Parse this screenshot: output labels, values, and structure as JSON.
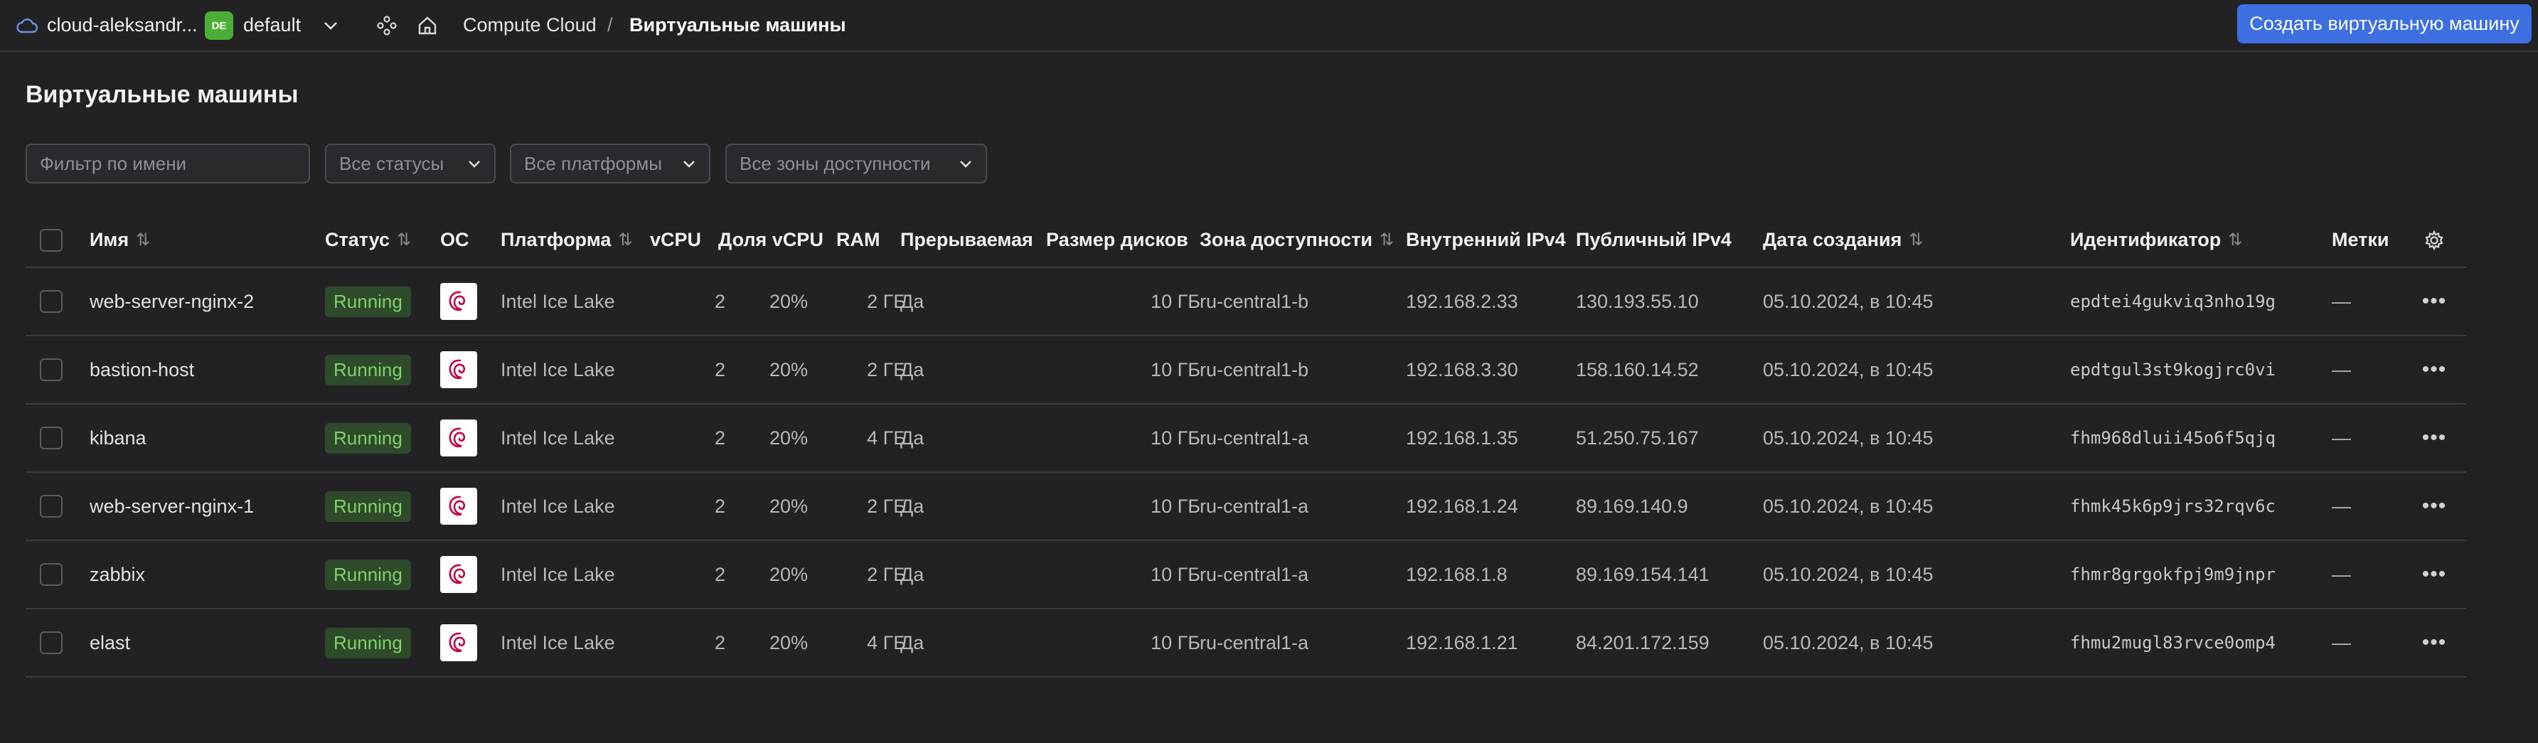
{
  "topbar": {
    "cloud_name": "cloud-aleksandr...",
    "folder_badge": "DE",
    "folder_name": "default",
    "breadcrumb": [
      "Compute Cloud",
      "/",
      "Виртуальные машины"
    ],
    "create_button": "Создать виртуальную машину",
    "icons": [
      "cloud-icon",
      "chevron-down-icon",
      "services-icon",
      "home-icon"
    ]
  },
  "page": {
    "title": "Виртуальные машины"
  },
  "filters": {
    "name_placeholder": "Фильтр по имени",
    "status": "Все статусы",
    "platform": "Все платформы",
    "zone": "Все зоны доступности"
  },
  "table": {
    "columns": [
      "Имя",
      "Статус",
      "ОС",
      "Платформа",
      "vCPU",
      "Доля vCPU",
      "RAM",
      "Прерываемая",
      "Размер дисков",
      "Зона доступности",
      "Внутренний IPv4",
      "Публичный IPv4",
      "Дата создания",
      "Идентификатор",
      "Метки"
    ],
    "rows": [
      {
        "name": "web-server-nginx-2",
        "status": "Running",
        "platform": "Intel Ice Lake",
        "vcpu": "2",
        "share": "20%",
        "ram": "2 ГБ",
        "preemptible": "Да",
        "disk": "10 ГБ",
        "zone": "ru-central1-b",
        "ip_internal": "192.168.2.33",
        "ip_public": "130.193.55.10",
        "created": "05.10.2024, в 10:45",
        "id": "epdtei4gukviq3nho19g",
        "labels": "—"
      },
      {
        "name": "bastion-host",
        "status": "Running",
        "platform": "Intel Ice Lake",
        "vcpu": "2",
        "share": "20%",
        "ram": "2 ГБ",
        "preemptible": "Да",
        "disk": "10 ГБ",
        "zone": "ru-central1-b",
        "ip_internal": "192.168.3.30",
        "ip_public": "158.160.14.52",
        "created": "05.10.2024, в 10:45",
        "id": "epdtgul3st9kogjrc0vi",
        "labels": "—"
      },
      {
        "name": "kibana",
        "status": "Running",
        "platform": "Intel Ice Lake",
        "vcpu": "2",
        "share": "20%",
        "ram": "4 ГБ",
        "preemptible": "Да",
        "disk": "10 ГБ",
        "zone": "ru-central1-a",
        "ip_internal": "192.168.1.35",
        "ip_public": "51.250.75.167",
        "created": "05.10.2024, в 10:45",
        "id": "fhm968dluii45o6f5qjq",
        "labels": "—"
      },
      {
        "name": "web-server-nginx-1",
        "status": "Running",
        "platform": "Intel Ice Lake",
        "vcpu": "2",
        "share": "20%",
        "ram": "2 ГБ",
        "preemptible": "Да",
        "disk": "10 ГБ",
        "zone": "ru-central1-a",
        "ip_internal": "192.168.1.24",
        "ip_public": "89.169.140.9",
        "created": "05.10.2024, в 10:45",
        "id": "fhmk45k6p9jrs32rqv6c",
        "labels": "—"
      },
      {
        "name": "zabbix",
        "status": "Running",
        "platform": "Intel Ice Lake",
        "vcpu": "2",
        "share": "20%",
        "ram": "2 ГБ",
        "preemptible": "Да",
        "disk": "10 ГБ",
        "zone": "ru-central1-a",
        "ip_internal": "192.168.1.8",
        "ip_public": "89.169.154.141",
        "created": "05.10.2024, в 10:45",
        "id": "fhmr8grgokfpj9m9jnpr",
        "labels": "—"
      },
      {
        "name": "elast",
        "status": "Running",
        "platform": "Intel Ice Lake",
        "vcpu": "2",
        "share": "20%",
        "ram": "4 ГБ",
        "preemptible": "Да",
        "disk": "10 ГБ",
        "zone": "ru-central1-a",
        "ip_internal": "192.168.1.21",
        "ip_public": "84.201.172.159",
        "created": "05.10.2024, в 10:45",
        "id": "fhmu2mugl83rvce0omp4",
        "labels": "—"
      }
    ]
  },
  "colors": {
    "background": "#222225",
    "accent": "#3d6fe0",
    "running": "#7ed36a",
    "folder_badge": "#4caf35"
  }
}
